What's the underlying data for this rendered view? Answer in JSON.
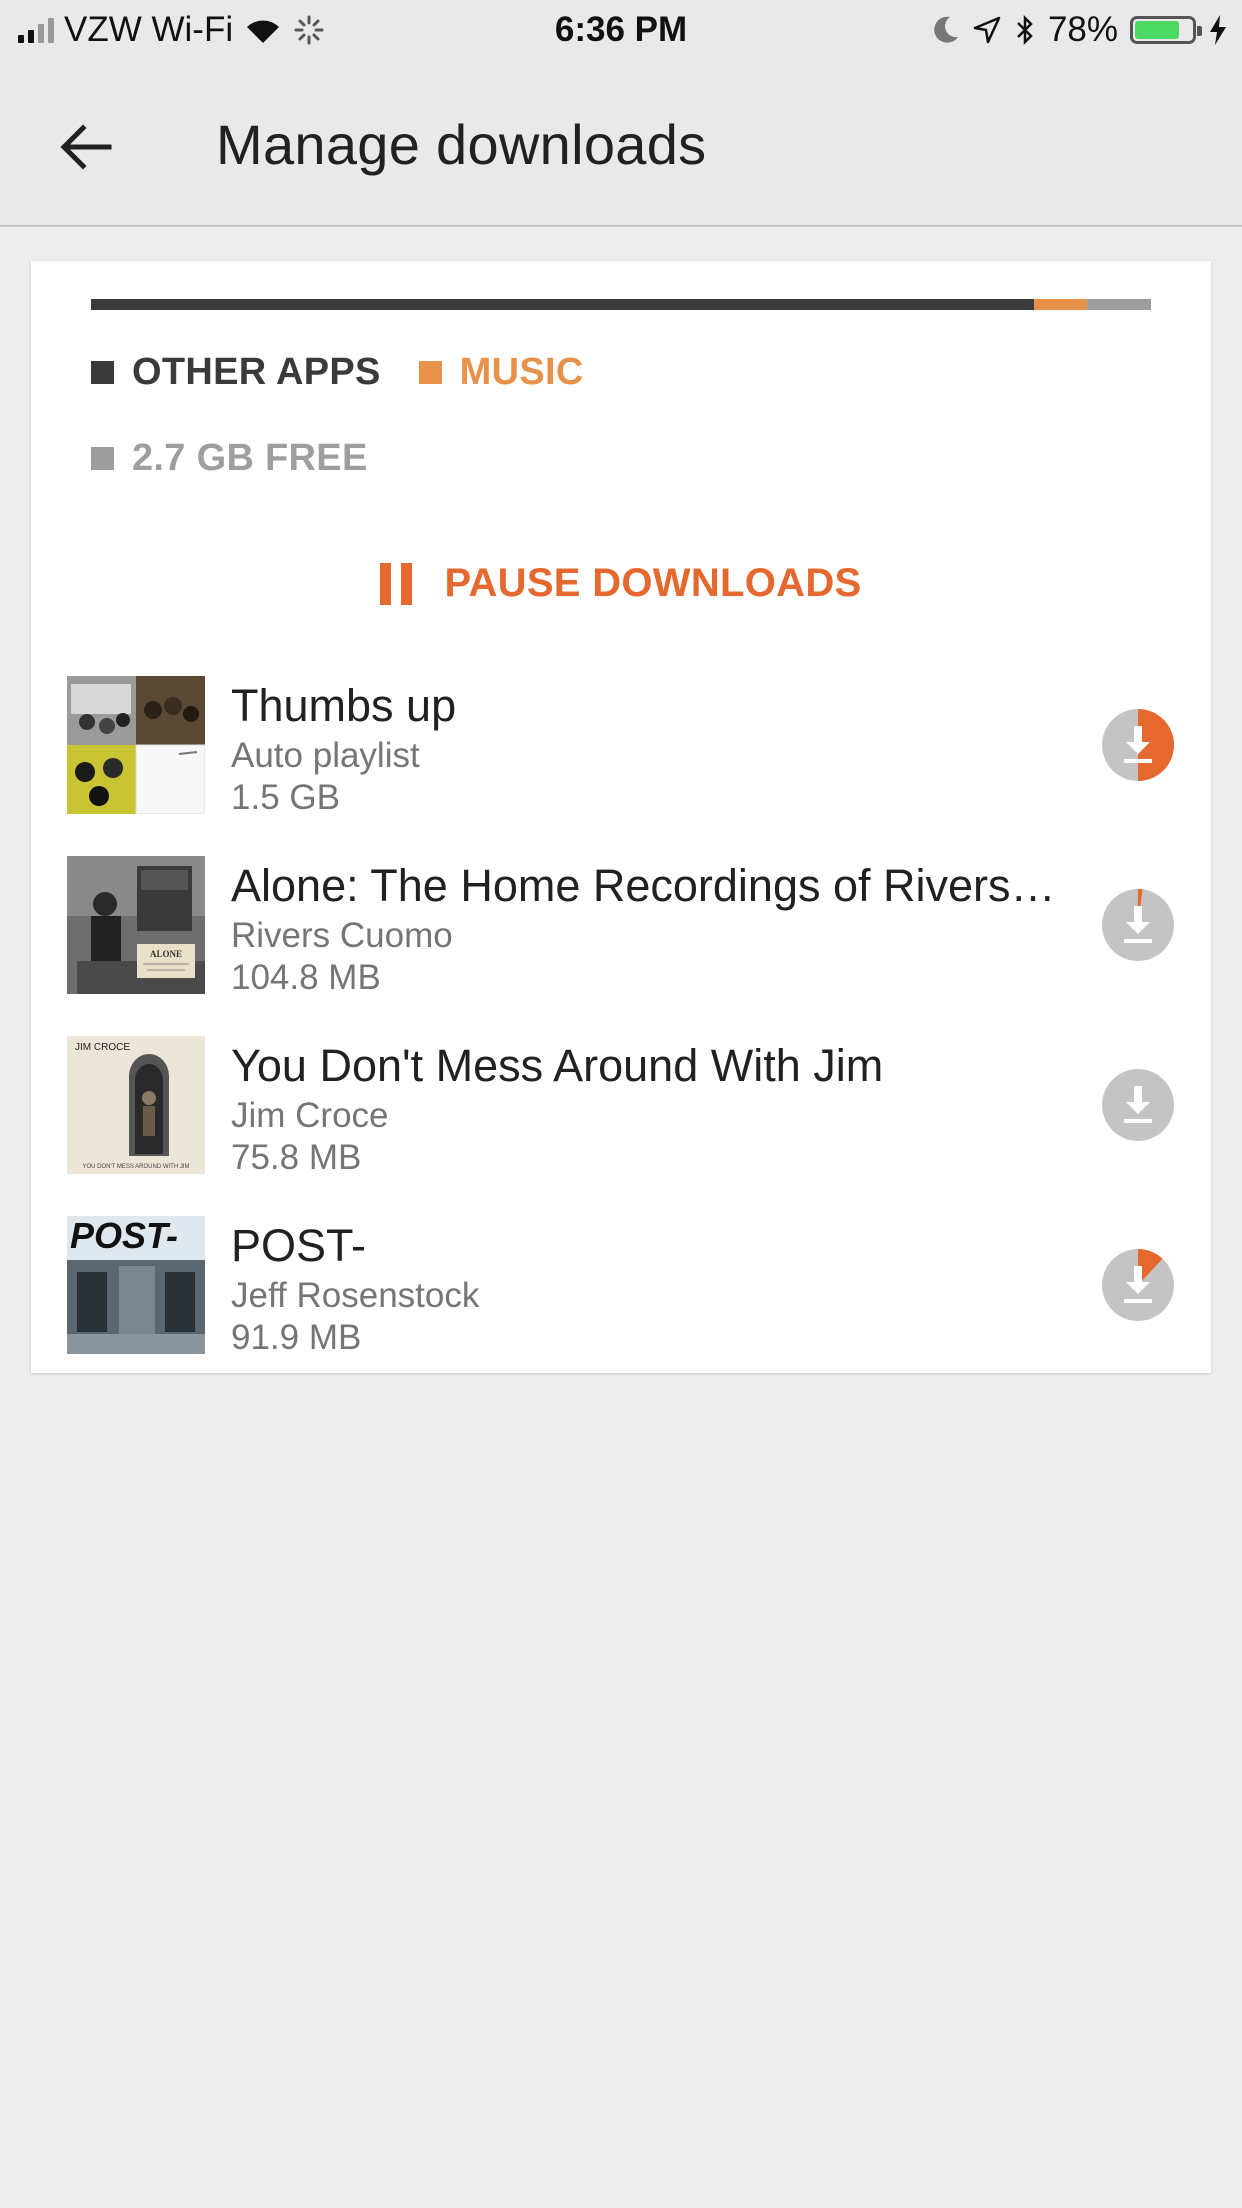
{
  "status_bar": {
    "carrier": "VZW Wi-Fi",
    "time": "6:36 PM",
    "battery": "78%",
    "battery_level": 0.78
  },
  "app_bar": {
    "title": "Manage downloads",
    "back_icon": "arrow-back-icon"
  },
  "storage": {
    "other_fraction": 0.89,
    "music_fraction": 0.05,
    "legend": {
      "other_apps": "OTHER APPS",
      "music": "MUSIC",
      "free": "2.7 GB FREE"
    },
    "colors": {
      "other": "#3a3a3a",
      "music": "#e8914a",
      "free": "#9e9e9e"
    }
  },
  "pause_label": "PAUSE DOWNLOADS",
  "accent_color": "#e5692f",
  "downloads": [
    {
      "title": "Thumbs up",
      "subtitle": "Auto playlist",
      "size": "1.5 GB",
      "progress": 0.5
    },
    {
      "title": "Alone: The Home Recordings of Rivers…",
      "subtitle": "Rivers Cuomo",
      "size": "104.8 MB",
      "progress": 0.02
    },
    {
      "title": "You Don't Mess Around With Jim",
      "subtitle": "Jim Croce",
      "size": "75.8 MB",
      "progress": 0.0
    },
    {
      "title": "POST-",
      "subtitle": "Jeff Rosenstock",
      "size": "91.9 MB",
      "progress": 0.12
    }
  ],
  "art": {
    "alone_label": "ALONE",
    "jim_croce_label": "JIM CROCE",
    "jim_croce_caption": "YOU DON'T MESS AROUND WITH JIM",
    "post_label": "POST-"
  }
}
